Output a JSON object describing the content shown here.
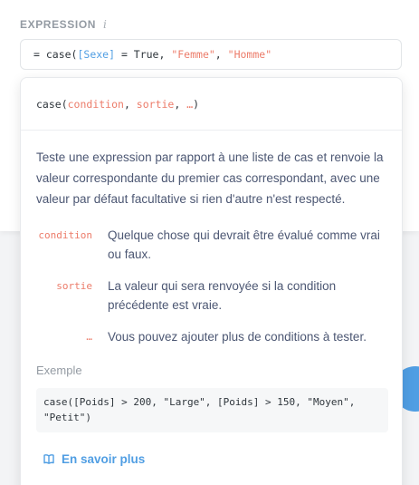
{
  "expression": {
    "label": "EXPRESSION",
    "info_icon": "info-icon",
    "tokens": [
      {
        "text": "= case(",
        "kind": "plain"
      },
      {
        "text": "[Sexe]",
        "kind": "field"
      },
      {
        "text": " = True, ",
        "kind": "plain"
      },
      {
        "text": "\"Femme\"",
        "kind": "string"
      },
      {
        "text": ", ",
        "kind": "plain"
      },
      {
        "text": "\"Homme\"",
        "kind": "string"
      }
    ]
  },
  "help": {
    "signature": {
      "name": "case(",
      "args": [
        "condition",
        "sortie",
        "…"
      ],
      "separator": ", ",
      "close": ")"
    },
    "description": "Teste une expression par rapport à une liste de cas et renvoie la valeur correspondante du premier cas correspondant, avec une valeur par défaut facultative si rien d'autre n'est respecté.",
    "arguments": [
      {
        "name": "condition",
        "description": "Quelque chose qui devrait être évalué comme vrai ou faux."
      },
      {
        "name": "sortie",
        "description": "La valeur qui sera renvoyée si la condition précédente est vraie."
      },
      {
        "name": "…",
        "description": "Vous pouvez ajouter plus de conditions à tester."
      }
    ],
    "example_label": "Exemple",
    "example_code": "case([Poids] > 200, \"Large\", [Poids] > 150, \"Moyen\",\n\"Petit\")",
    "learn_more": "En savoir plus",
    "learn_more_icon": "book-icon"
  },
  "colors": {
    "accent": "#509ee3",
    "argument": "#ec7c6a"
  }
}
